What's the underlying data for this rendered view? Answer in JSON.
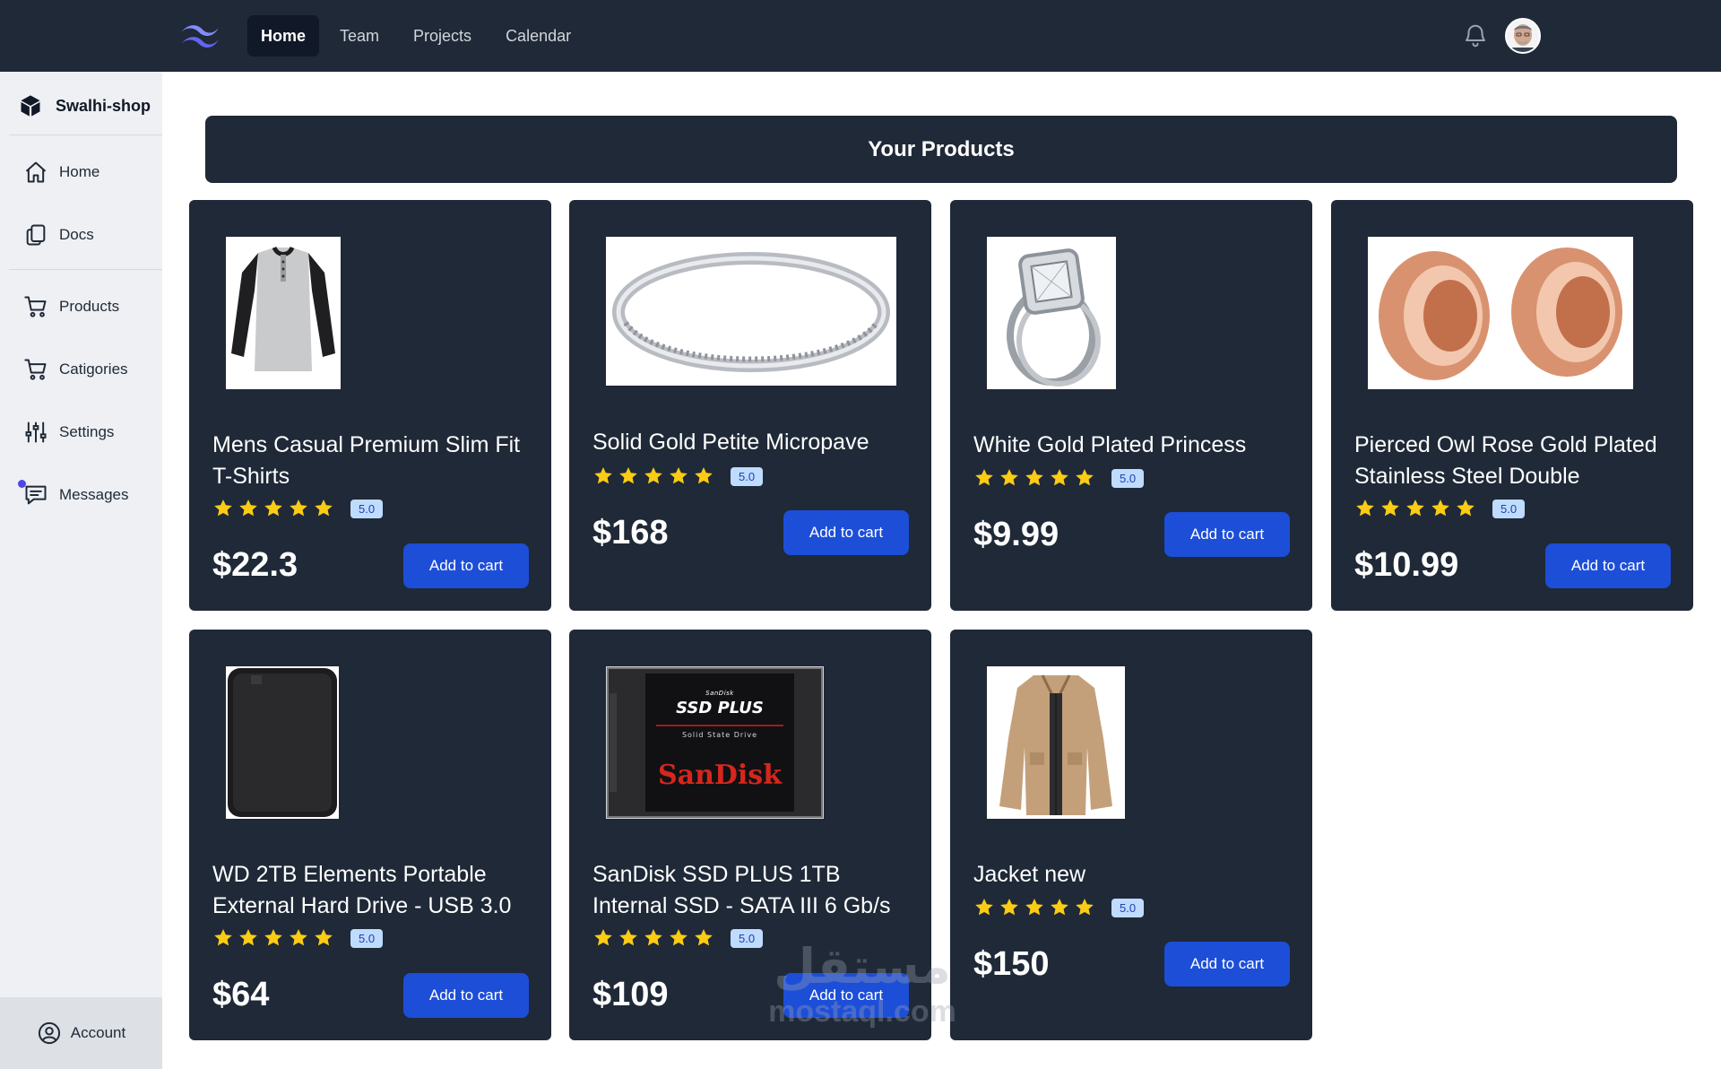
{
  "topnav": {
    "items": [
      {
        "label": "Home",
        "active": true
      },
      {
        "label": "Team",
        "active": false
      },
      {
        "label": "Projects",
        "active": false
      },
      {
        "label": "Calendar",
        "active": false
      }
    ],
    "icons": [
      "logo-icon",
      "bell-icon",
      "avatar"
    ]
  },
  "sidebar": {
    "brand": "Swalhi-shop",
    "items": [
      {
        "label": "Home",
        "icon": "home-icon"
      },
      {
        "label": "Docs",
        "icon": "docs-icon"
      },
      {
        "label": "Products",
        "icon": "cart-icon"
      },
      {
        "label": "Catigories",
        "icon": "cart-icon"
      },
      {
        "label": "Settings",
        "icon": "sliders-icon"
      },
      {
        "label": "Messages",
        "icon": "message-icon"
      }
    ],
    "account": "Account"
  },
  "main": {
    "heading": "Your Products",
    "products": [
      {
        "title": "Mens Casual Premium Slim Fit T-Shirts",
        "rating": "5.0",
        "stars": 5,
        "price": "$22.3",
        "button": "Add to cart",
        "image": "tshirt"
      },
      {
        "title": "Solid Gold Petite Micropave",
        "rating": "5.0",
        "stars": 5,
        "price": "$168",
        "button": "Add to cart",
        "image": "ring-band"
      },
      {
        "title": "White Gold Plated Princess",
        "rating": "5.0",
        "stars": 5,
        "price": "$9.99",
        "button": "Add to cart",
        "image": "ring-princess"
      },
      {
        "title": "Pierced Owl Rose Gold Plated Stainless Steel Double",
        "rating": "5.0",
        "stars": 5,
        "price": "$10.99",
        "button": "Add to cart",
        "image": "plugs"
      },
      {
        "title": "WD 2TB Elements Portable External Hard Drive - USB 3.0",
        "rating": "5.0",
        "stars": 5,
        "price": "$64",
        "button": "Add to cart",
        "image": "hdd"
      },
      {
        "title": "SanDisk SSD PLUS 1TB Internal SSD - SATA III 6 Gb/s",
        "rating": "5.0",
        "stars": 5,
        "price": "$109",
        "button": "Add to cart",
        "image": "ssd"
      },
      {
        "title": "Jacket new",
        "rating": "5.0",
        "stars": 5,
        "price": "$150",
        "button": "Add to cart",
        "image": "jacket"
      }
    ],
    "ssd_label": {
      "brand_small": "SanDisk",
      "line1": "SSD PLUS",
      "line2": "Solid State Drive",
      "logo": "SanDisk"
    }
  },
  "watermark": {
    "arabic": "مستقل",
    "latin": "mostaql.com"
  },
  "colors": {
    "navbar": "#1f2937",
    "card": "#1f2937",
    "button": "#1d4ed8",
    "star": "#facc15",
    "badge_bg": "#bfdbfe",
    "sidebar": "#eef0f3"
  }
}
